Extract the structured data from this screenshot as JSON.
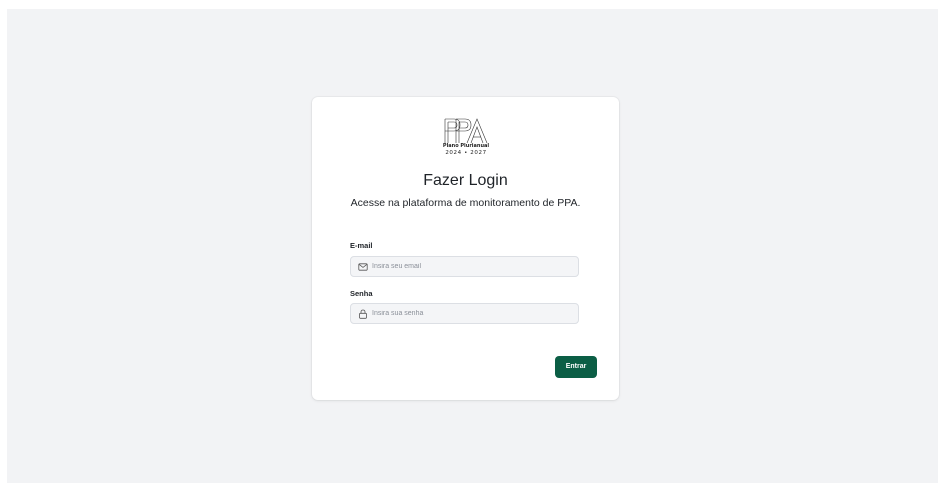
{
  "logo": {
    "icon": "ppa-logo",
    "name": "Plano Plurianual",
    "years": "2024 • 2027"
  },
  "login": {
    "title": "Fazer Login",
    "subtitle": "Acesse na plataforma de monitoramento de PPA.",
    "email": {
      "label": "E-mail",
      "placeholder": "Insira seu email",
      "icon": "mail-icon"
    },
    "password": {
      "label": "Senha",
      "placeholder": "Insira sua senha",
      "icon": "lock-icon"
    },
    "submit_label": "Entrar"
  },
  "colors": {
    "background": "#f2f3f5",
    "card": "#ffffff",
    "primary": "#0b5e45",
    "input_bg": "#f4f5f7"
  }
}
